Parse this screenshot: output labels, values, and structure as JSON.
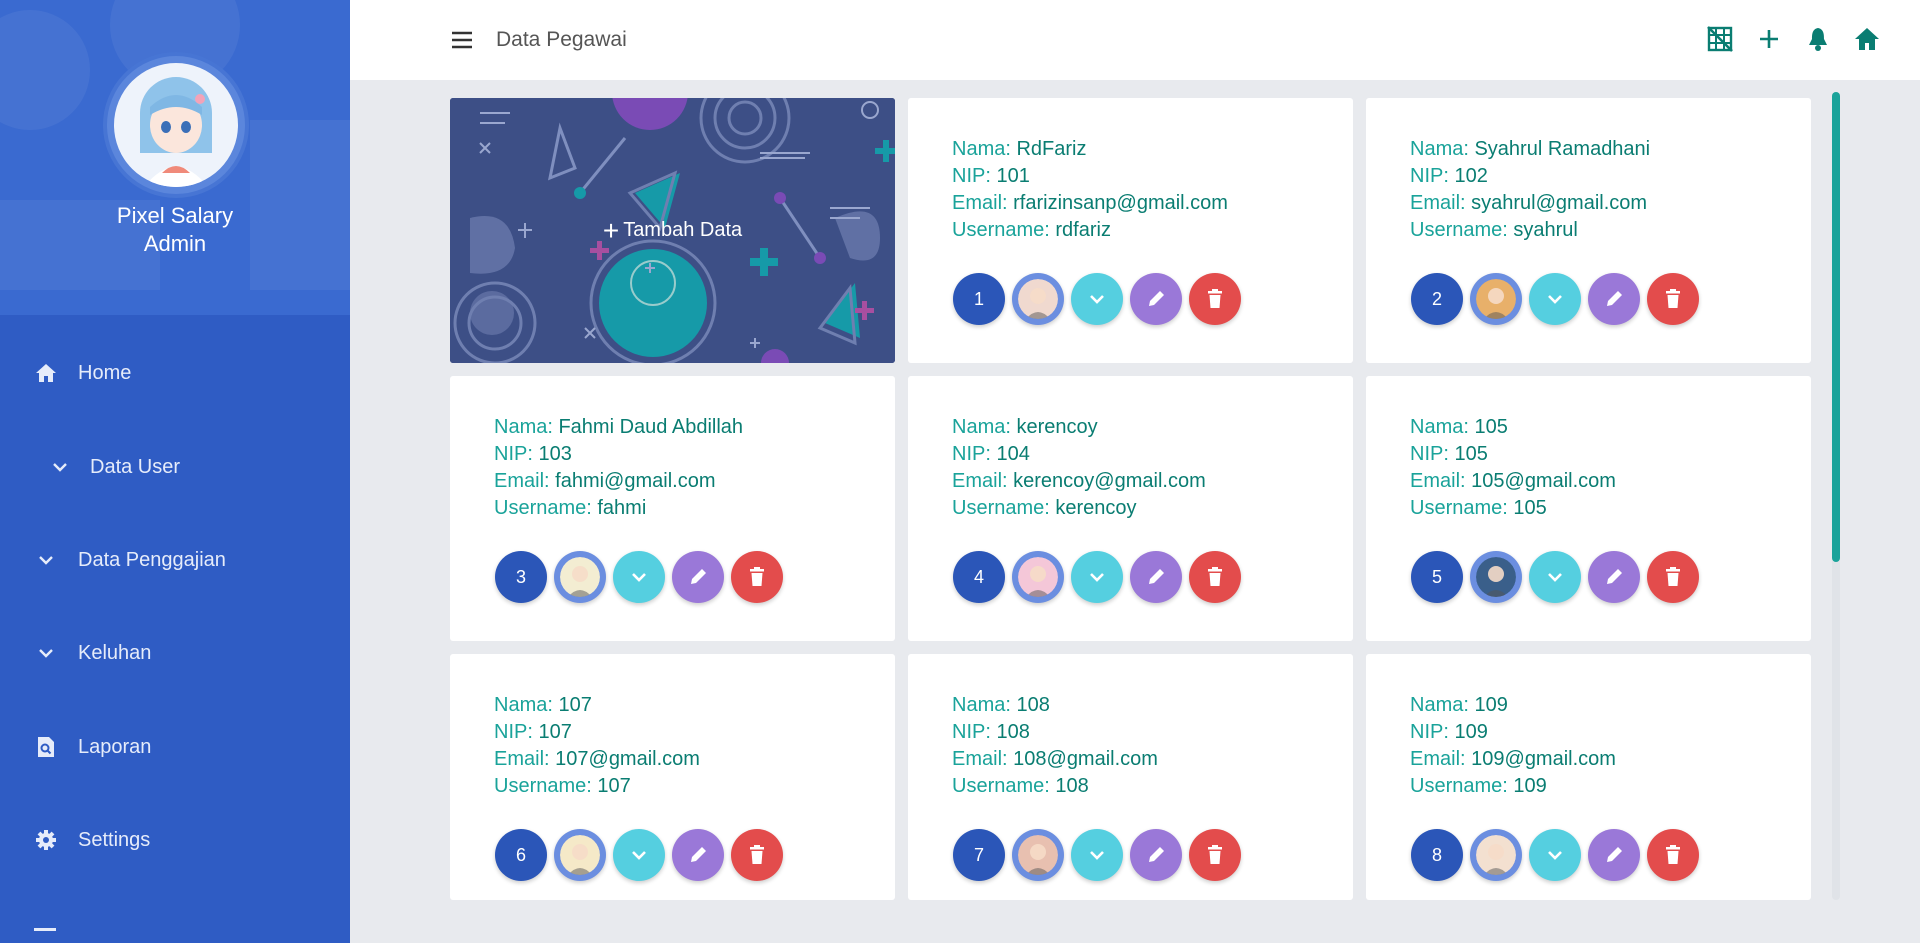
{
  "sidebar": {
    "app_name_line1": "Pixel Salary",
    "app_name_line2": "Admin",
    "items": [
      {
        "label": "Home",
        "icon": "home-icon"
      },
      {
        "label": "Data User",
        "icon": "chevron-down-icon"
      },
      {
        "label": "Data Penggajian",
        "icon": "chevron-down-icon"
      },
      {
        "label": "Keluhan",
        "icon": "chevron-down-icon"
      },
      {
        "label": "Laporan",
        "icon": "search-document-icon"
      },
      {
        "label": "Settings",
        "icon": "gear-icon"
      }
    ]
  },
  "header": {
    "title": "Data Pegawai",
    "icons": [
      "grid-off-icon",
      "plus-icon",
      "bell-icon",
      "home-icon"
    ]
  },
  "add_card": {
    "label": "Tambah Data"
  },
  "labels": {
    "nama": "Nama:",
    "nip": "NIP:",
    "email": "Email:",
    "username": "Username:"
  },
  "employees": [
    {
      "no": "1",
      "nama": "RdFariz",
      "nip": "101",
      "email": "rfarizinsanp@gmail.com",
      "username": "rdfariz"
    },
    {
      "no": "2",
      "nama": "Syahrul Ramadhani",
      "nip": "102",
      "email": "syahrul@gmail.com",
      "username": "syahrul"
    },
    {
      "no": "3",
      "nama": "Fahmi Daud Abdillah",
      "nip": "103",
      "email": "fahmi@gmail.com",
      "username": "fahmi"
    },
    {
      "no": "4",
      "nama": "kerencoy",
      "nip": "104",
      "email": "kerencoy@gmail.com",
      "username": "kerencoy"
    },
    {
      "no": "5",
      "nama": "105",
      "nip": "105",
      "email": "105@gmail.com",
      "username": "105"
    },
    {
      "no": "6",
      "nama": "107",
      "nip": "107",
      "email": "107@gmail.com",
      "username": "107"
    },
    {
      "no": "7",
      "nama": "108",
      "nip": "108",
      "email": "108@gmail.com",
      "username": "108"
    },
    {
      "no": "8",
      "nama": "109",
      "nip": "109",
      "email": "109@gmail.com",
      "username": "109"
    }
  ],
  "colors": {
    "sidebar": "#2f5cc4",
    "accent": "#1aa39a",
    "delete": "#e34c4c",
    "edit": "#9a78d8",
    "expand": "#55cfe0"
  }
}
